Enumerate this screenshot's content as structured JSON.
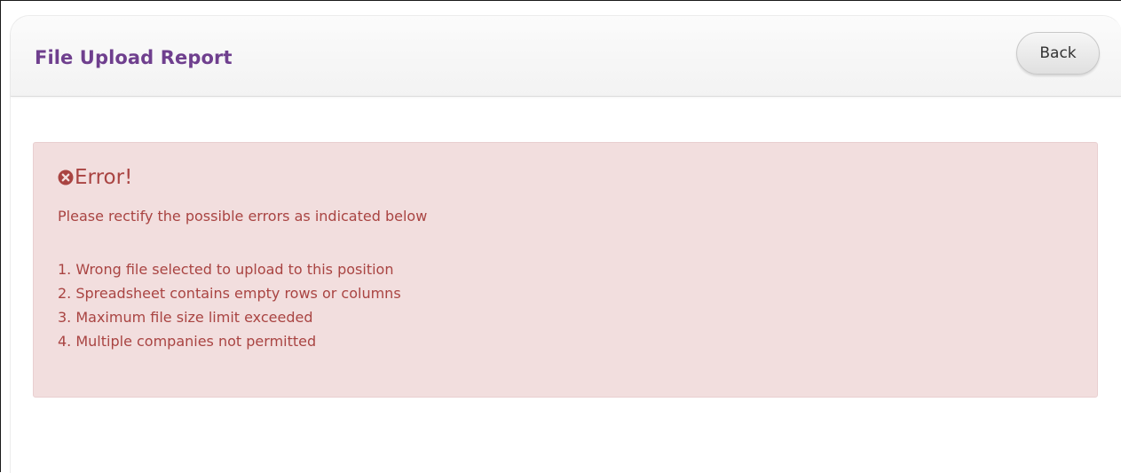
{
  "header": {
    "title": "File Upload Report",
    "back_label": "Back"
  },
  "alert": {
    "icon": "times-circle-icon",
    "heading": "Error!",
    "message": "Please rectify the possible errors as indicated below",
    "errors": [
      "1. Wrong file selected to upload to this position",
      "2. Spreadsheet contains empty rows or columns",
      "3. Maximum file size limit exceeded",
      "4. Multiple companies not permitted"
    ]
  },
  "colors": {
    "title": "#6f3f8e",
    "alert_background": "#f2dede",
    "alert_text": "#a94442"
  }
}
